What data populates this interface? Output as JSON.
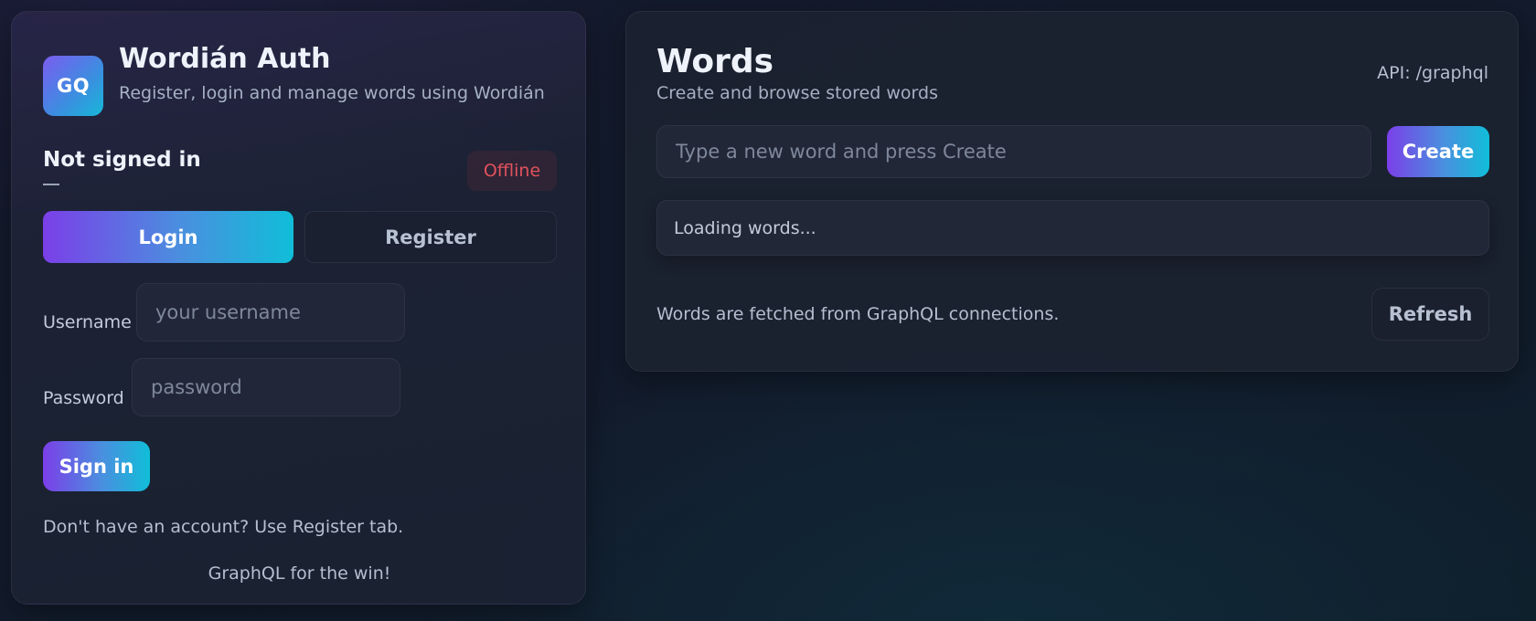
{
  "auth": {
    "logo_text": "GQ",
    "title": "Wordián Auth",
    "subtitle": "Register, login and manage words using Wordián",
    "status": "Not signed in",
    "status_detail": "—",
    "badge": "Offline",
    "tabs": [
      {
        "label": "Login",
        "active": true
      },
      {
        "label": "Register",
        "active": false
      }
    ],
    "form": {
      "username_label": "Username",
      "username_placeholder": "your username",
      "username_value": "",
      "password_label": "Password",
      "password_placeholder": "password",
      "password_value": "",
      "submit_label": "Sign in"
    },
    "hint": "Don't have an account? Use Register tab.",
    "footer": "GraphQL for the win!"
  },
  "words": {
    "title": "Words",
    "subtitle": "Create and browse stored words",
    "api_label": "API: /graphql",
    "input_placeholder": "Type a new word and press Create",
    "input_value": "",
    "create_label": "Create",
    "loading_text": "Loading words...",
    "note": "Words are fetched from GraphQL connections.",
    "refresh_label": "Refresh"
  },
  "colors": {
    "accent_start": "#7b3fe8",
    "accent_end": "#10bed8",
    "offline": "#e0525c",
    "background": "#131b2c"
  }
}
